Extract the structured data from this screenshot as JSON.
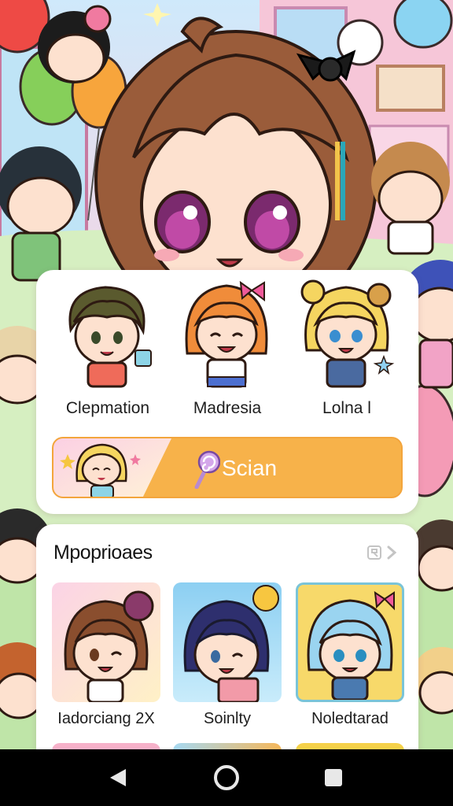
{
  "featured": {
    "characters": [
      {
        "name": "Clepmation"
      },
      {
        "name": "Madresia"
      },
      {
        "name": "Lolna l"
      }
    ],
    "scan_button": {
      "label": "Scian"
    }
  },
  "popular": {
    "title": "Mpoprioaes",
    "items": [
      {
        "name": "Iadorciang 2X"
      },
      {
        "name": "Soinlty"
      },
      {
        "name": "Noledtarad"
      }
    ]
  },
  "navbar": {
    "back_icon": "back-triangle",
    "home_icon": "home-circle",
    "recents_icon": "recents-square"
  },
  "colors": {
    "accent": "#f7b24a",
    "card": "#ffffff",
    "nav": "#000000"
  }
}
